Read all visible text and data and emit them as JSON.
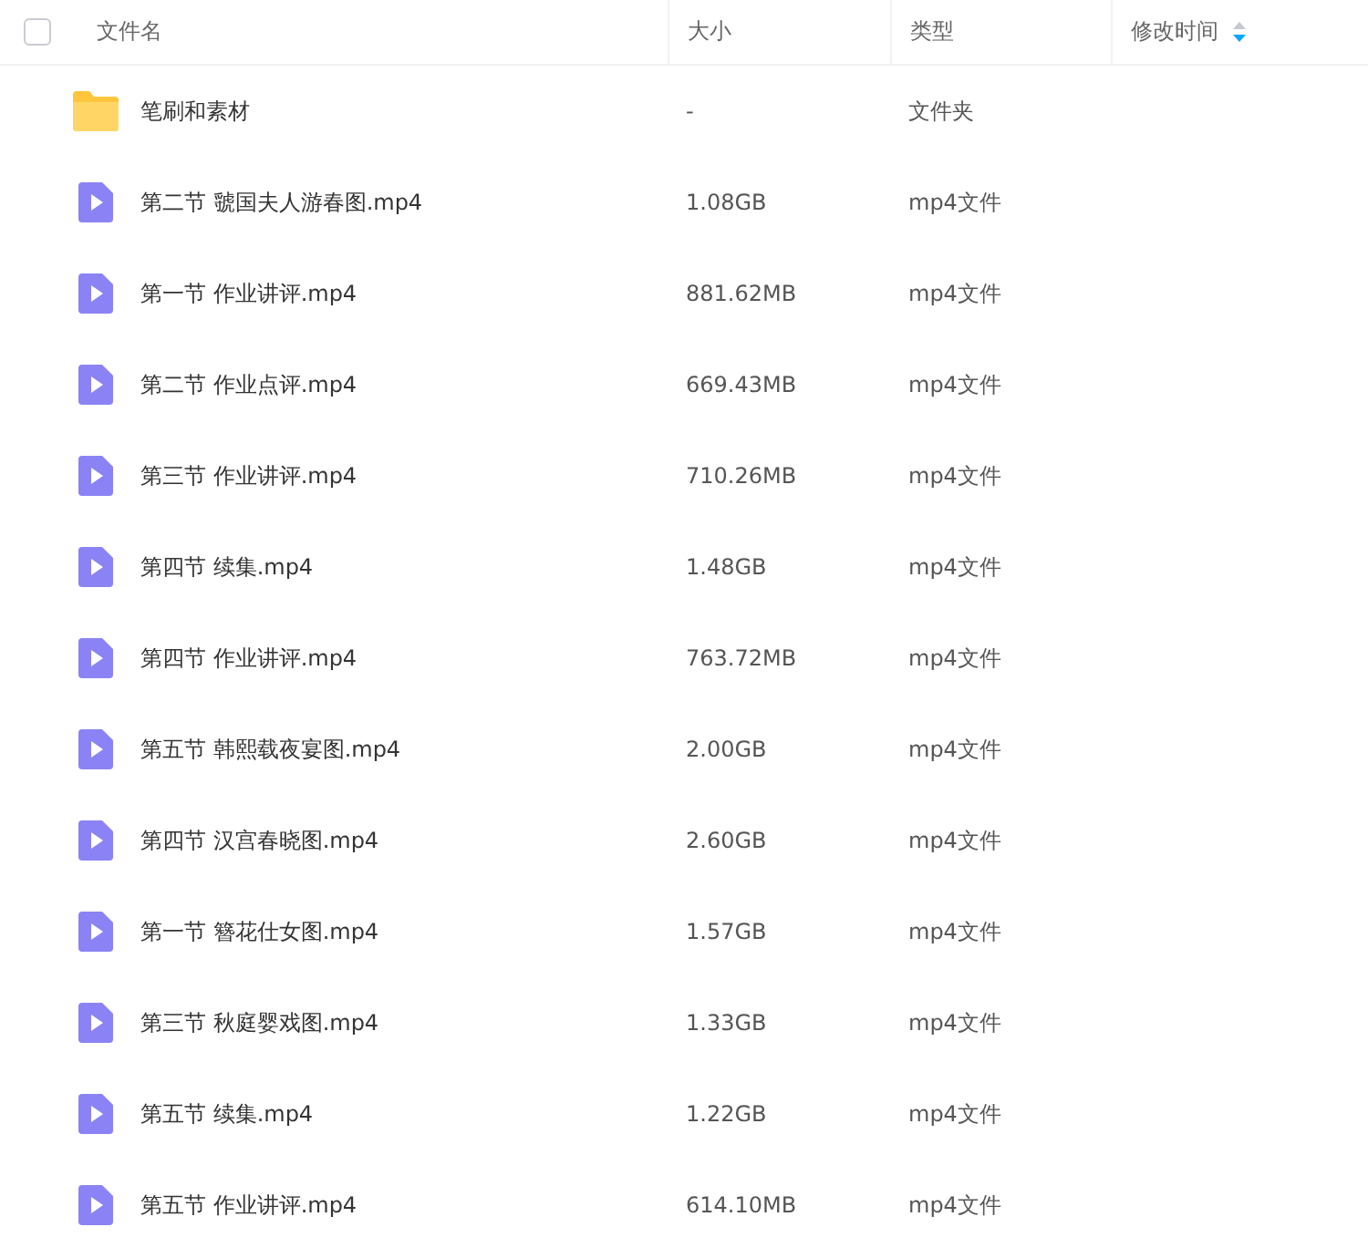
{
  "header": {
    "select_all": {
      "checked": false
    },
    "columns": [
      {
        "label": "文件名"
      },
      {
        "label": "大小"
      },
      {
        "label": "类型"
      },
      {
        "label": "修改时间",
        "sorted": true,
        "descending": true
      }
    ]
  },
  "rows": [
    {
      "kind": "folder",
      "name": "笔刷和素材",
      "size": "-",
      "type": "文件夹"
    },
    {
      "kind": "video",
      "name": "第二节 虢国夫人游春图.mp4",
      "size": "1.08GB",
      "type": "mp4文件"
    },
    {
      "kind": "video",
      "name": "第一节 作业讲评.mp4",
      "size": "881.62MB",
      "type": "mp4文件"
    },
    {
      "kind": "video",
      "name": "第二节 作业点评.mp4",
      "size": "669.43MB",
      "type": "mp4文件"
    },
    {
      "kind": "video",
      "name": "第三节 作业讲评.mp4",
      "size": "710.26MB",
      "type": "mp4文件"
    },
    {
      "kind": "video",
      "name": "第四节 续集.mp4",
      "size": "1.48GB",
      "type": "mp4文件"
    },
    {
      "kind": "video",
      "name": "第四节 作业讲评.mp4",
      "size": "763.72MB",
      "type": "mp4文件"
    },
    {
      "kind": "video",
      "name": "第五节 韩熙载夜宴图.mp4",
      "size": "2.00GB",
      "type": "mp4文件"
    },
    {
      "kind": "video",
      "name": "第四节 汉宫春晓图.mp4",
      "size": "2.60GB",
      "type": "mp4文件"
    },
    {
      "kind": "video",
      "name": "第一节 簪花仕女图.mp4",
      "size": "1.57GB",
      "type": "mp4文件"
    },
    {
      "kind": "video",
      "name": "第三节 秋庭婴戏图.mp4",
      "size": "1.33GB",
      "type": "mp4文件"
    },
    {
      "kind": "video",
      "name": "第五节 续集.mp4",
      "size": "1.22GB",
      "type": "mp4文件"
    },
    {
      "kind": "video",
      "name": "第五节 作业讲评.mp4",
      "size": "614.10MB",
      "type": "mp4文件"
    }
  ]
}
